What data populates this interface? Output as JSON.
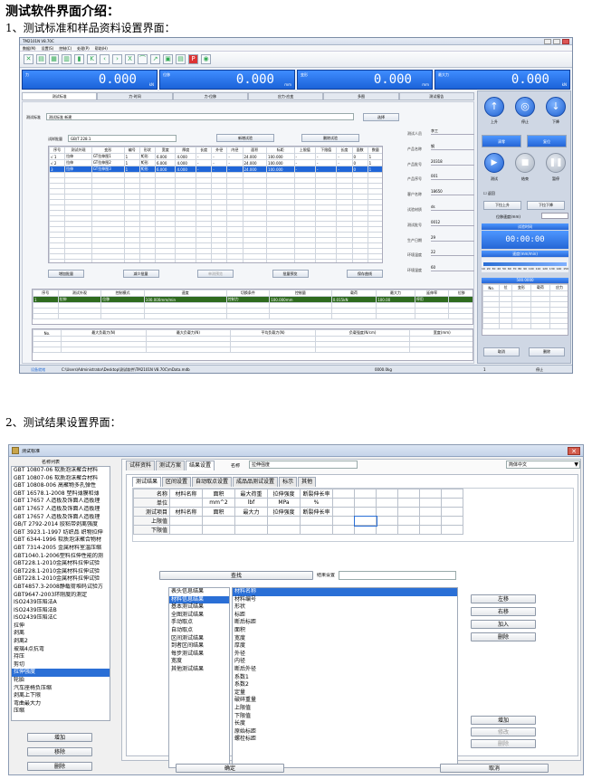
{
  "doc": {
    "title": "测试软件界面介绍：",
    "section1": "1、测试标准和样品资料设置界面：",
    "section2": "2、测试结果设置界面："
  },
  "win1": {
    "title": "TM2101N V8.70C",
    "menu": [
      "数据(M)",
      "设置(S)",
      "控制(C)",
      "处理(P)",
      "帮助(H)"
    ],
    "toolbar_icons": [
      "x-icon",
      "folder-icon",
      "chart-icon",
      "chart2-icon",
      "trash-icon",
      "back-icon",
      "prev-icon",
      "next-icon",
      "forward-icon",
      "curve-icon",
      "export-icon",
      "table-icon",
      "table2-icon",
      "pdf-icon",
      "camera-icon"
    ],
    "meters": [
      {
        "label": "力",
        "value": "0.000",
        "unit": "kN"
      },
      {
        "label": "位移",
        "value": "0.000",
        "unit": "mm"
      },
      {
        "label": "变形",
        "value": "0.000",
        "unit": "mm"
      },
      {
        "label": "最大力",
        "value": "0.000",
        "unit": "kN"
      }
    ],
    "tabs": [
      "测试标准",
      "力-时间",
      "力-位移",
      "应力-应变",
      "多图",
      "测试报告"
    ],
    "standard_label": "测试标准",
    "standard_value": "测试标准 新建",
    "select_btn": "选择",
    "sample_group_label": "试样批量",
    "sample_group_value": "GB/T 228.1",
    "new_test_btn": "新增试验",
    "delete_test_btn": "删除试验",
    "table_headers": [
      "序号",
      "测试外观",
      "变形",
      "编号",
      "形状",
      "宽度",
      "厚度",
      "长度",
      "外径",
      "内径",
      "面积",
      "标距",
      "上限值",
      "下限值",
      "长度",
      "面数",
      "数量"
    ],
    "table_rows": [
      [
        "√ 1",
        "拉伸",
        "GT拉伸图1",
        "1",
        "矩形",
        "6.000",
        "4.000",
        "-",
        "-",
        "-",
        "24.000",
        "100.000",
        "-",
        "-",
        "-",
        "0",
        "1"
      ],
      [
        "√ 2",
        "拉伸",
        "GT拉伸图2",
        "1",
        "矩形",
        "6.000",
        "4.000",
        "-",
        "-",
        "-",
        "24.000",
        "100.000",
        "-",
        "-",
        "-",
        "0",
        "1"
      ],
      [
        "3",
        "拉伸",
        "GT拉伸图3",
        "1",
        "矩形",
        "6.000",
        "4.000",
        "-",
        "-",
        "-",
        "24.000",
        "100.000",
        "-",
        "-",
        "-",
        "0",
        "1"
      ]
    ],
    "bottom_btns": [
      "增加批量",
      "减少批量",
      "单测预览",
      "批量预览",
      "保存曲线"
    ],
    "result_headers": [
      "序号",
      "测试外观",
      "控制模式",
      "速度",
      "切换条件",
      "控制量",
      "载荷",
      "最大力",
      "延伸率",
      "位移"
    ],
    "result_row": [
      "1",
      "拉伸",
      "位移",
      "100.000mm/min",
      "控制力",
      "100.000mm",
      "0.015kN",
      "100.00",
      "停用"
    ],
    "stat_headers": [
      "No.",
      "最大负载力(N)",
      "最大负载力(N)",
      "平均负载力(N)",
      "负载强度(N/cm)",
      "宽度(mm)"
    ],
    "right_fields": [
      {
        "label": "测试人员",
        "value": "李工"
      },
      {
        "label": "产品名称",
        "value": "钢"
      },
      {
        "label": "产品批号",
        "value": "20318"
      },
      {
        "label": "产品序号",
        "value": "001"
      },
      {
        "label": "客户名称",
        "value": "18650"
      },
      {
        "label": "试验材质",
        "value": "ds"
      },
      {
        "label": "测试批号",
        "value": "0012"
      },
      {
        "label": "生产日期",
        "value": "29"
      },
      {
        "label": "环境温度",
        "value": "22"
      },
      {
        "label": "环境湿度",
        "value": "60"
      }
    ],
    "ctrl_buttons": [
      "上升",
      "停止",
      "下降"
    ],
    "zero_btn": "清零",
    "reset_btn": "复位",
    "run_buttons": [
      "测试",
      "结束",
      "暂停"
    ],
    "auto_return": "返回",
    "down_fast": "下拉上升",
    "down_slow": "下拉下降",
    "speed_label": "位移速度(mm)",
    "time_label": "试验时间",
    "timer": "00:00:00",
    "speed_bar_label": "速度(mm/min)",
    "scale": [
      "10",
      "20",
      "30",
      "40",
      "50",
      "60",
      "70",
      "80",
      "90",
      "100",
      "110",
      "120",
      "130",
      "140",
      "150"
    ],
    "mini_table_title": "500.0000",
    "mini_headers": [
      "No.",
      "位",
      "变形",
      "载荷",
      "应力"
    ],
    "confirm_btn": "取消",
    "delete_btn": "删除",
    "status": {
      "ready": "设备就绪",
      "path": "C:\\Users\\Administrator\\Desktop\\测试软件\\TM2101N V8.70C\\mData.mdb",
      "speed": "0000.0kg",
      "count": "1",
      "state": "停止"
    }
  },
  "win2": {
    "title": "测试标准",
    "list_header": "名称列表",
    "list_items": [
      "GBT 10807-06 软质泡沫聚合材料",
      "GBT 10807-06 软质泡沫聚合材料",
      "GBT 10808-006 高聚物多孔弹性",
      "GBT 16578.1-2008 塑料薄膜和薄",
      "GBT 17657 人造板及饰面人造板理",
      "GBT 17657 人造板及饰面人造板理",
      "GBT 17657 人造板及饰面人造板理",
      "GB/T 2792-2014 胶粘带剥离强度",
      "GBT 3923.1-1997 纺织品 织物拉伸",
      "GBT 6344-1996 软质泡沫聚合物材",
      "GBT 7314-2005 金属材料室温压缩",
      "GBT1040.1-2006塑料拉伸性能的测",
      "GBT228.1-2010金属材料拉伸试验",
      "GBT228.1-2010金属材料拉伸试验",
      "GBT228.1-2010金属材料拉伸试验",
      "GBT4857.3-2008静载荷堆码试验方",
      "GBT9647-2003环刚度的测定",
      "ISO2439压陷法A",
      "ISO2439压陷法B",
      "ISO2439压陷法C",
      "拉伸",
      "剥离",
      "剥离2",
      "玻璃4点抗弯",
      "持压",
      "剪切",
      "拉伸强度",
      "轮胎",
      "汽车座椅负压缩",
      "剥离上下限",
      "弯曲最大力",
      "压缩"
    ],
    "list_selected": 26,
    "add_btn": "增加",
    "remove_btn": "移除",
    "delete_btn": "删除",
    "top_tabs": [
      "试样资料",
      "测试方案",
      "结果设置"
    ],
    "name_label": "名称",
    "name_value": "拉伸强度",
    "language": "简体中文",
    "sub_tabs": [
      "测试结果",
      "区间设置",
      "自动取点设置",
      "成品品测试设置",
      "标示",
      "其他"
    ],
    "result_rows": [
      [
        "名称",
        "材料名称",
        "面积",
        "最大荷重",
        "拉伸强度",
        "断裂伸长率"
      ],
      [
        "单位",
        "",
        "mm^2",
        "lbf",
        "MPa",
        "%"
      ],
      [
        "测试项目",
        "材料名称",
        "面积",
        "最大力",
        "拉伸强度",
        "断裂伸长率"
      ],
      [
        "上限值",
        "",
        "",
        "",
        "",
        ""
      ],
      [
        "下限值",
        "",
        "",
        "",
        "",
        ""
      ]
    ],
    "find_btn": "查找",
    "result_set_label": "结果设置",
    "categories": [
      "表头信息结果",
      "材料信息结果",
      "基本测试结果",
      "全图测试结果",
      "手动取点",
      "自动取点",
      "区间测试结果",
      "到者区间结果",
      "每步测试结果",
      "宽度",
      "其他测试结果"
    ],
    "category_selected": 1,
    "columns": [
      "材料名称",
      "材料编号",
      "形状",
      "标距",
      "断后标距",
      "面积",
      "宽度",
      "厚度",
      "外径",
      "内径",
      "断后外径",
      "系数1",
      "系数2",
      "定量",
      "破碎重量",
      "上限值",
      "下限值",
      "长度",
      "原始标距",
      "螺栓标距"
    ],
    "column_selected": 0,
    "side_btns": [
      "左移",
      "右移",
      "加入",
      "删除"
    ],
    "lower_btns": [
      "增加",
      "修改",
      "删除"
    ],
    "ok_btn": "确定",
    "cancel_btn": "取消"
  }
}
